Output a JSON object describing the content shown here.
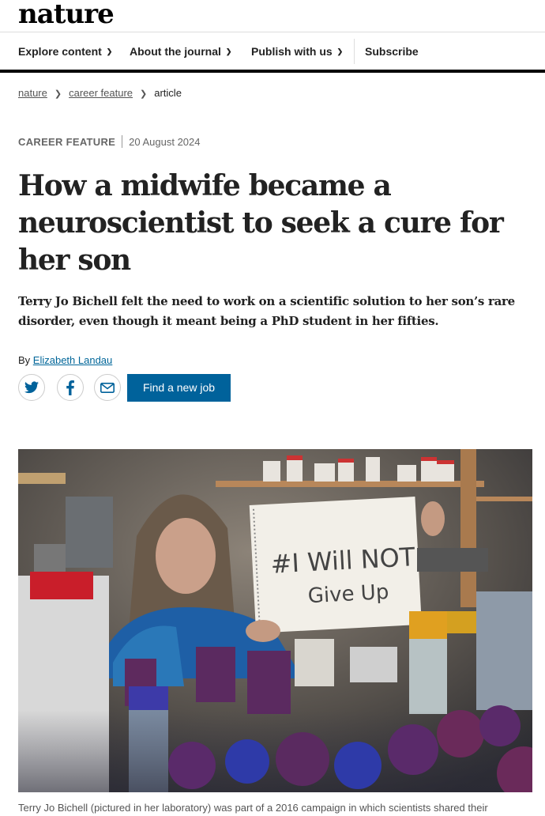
{
  "brand": {
    "logo": "nature"
  },
  "nav": {
    "items": [
      {
        "label": "Explore content",
        "has_dropdown": true
      },
      {
        "label": "About the journal",
        "has_dropdown": true
      },
      {
        "label": "Publish with us",
        "has_dropdown": true
      }
    ],
    "subscribe": "Subscribe"
  },
  "breadcrumb": {
    "items": [
      "nature",
      "career feature"
    ],
    "current": "article"
  },
  "article": {
    "type": "CAREER FEATURE",
    "date": "20 August 2024",
    "title": "How a midwife became a neuroscientist to seek a cure for her son",
    "standfirst": "Terry Jo Bichell felt the need to work on a scientific solution to her son’s rare disorder, even though it meant being a PhD student in her fifties.",
    "byline_prefix": "By",
    "author": "Elizabeth Landau"
  },
  "share": {
    "icons": [
      "twitter-icon",
      "facebook-icon",
      "email-icon"
    ]
  },
  "job_button": "Find a new job",
  "image": {
    "sign_line1": "#I Will NOT",
    "sign_line2": "Give Up",
    "caption": "Terry Jo Bichell (pictured in her laboratory) was part of a 2016 campaign in which scientists shared their"
  },
  "colors": {
    "accent": "#00629b",
    "text": "#222222",
    "link": "#006699"
  }
}
